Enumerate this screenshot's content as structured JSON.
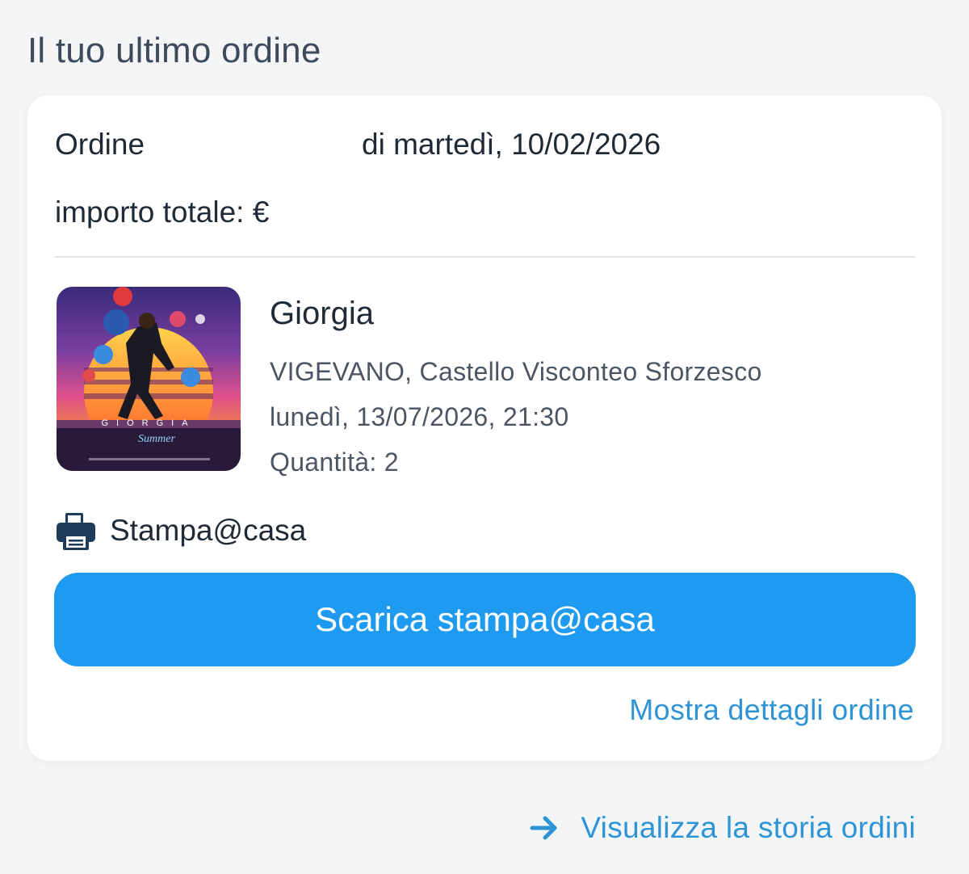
{
  "section": {
    "title": "Il tuo ultimo ordine"
  },
  "order": {
    "label": "Ordine",
    "date": "di martedì, 10/02/2026",
    "total": "importo totale: €"
  },
  "event": {
    "image_icon": "event-poster-image",
    "image_text": "GIORGIA Summer",
    "title": "Giorgia",
    "venue": "VIGEVANO, Castello Visconteo Sforzesco",
    "datetime": "lunedì, 13/07/2026, 21:30",
    "quantity": "Quantità: 2"
  },
  "delivery": {
    "icon": "printer-icon",
    "label": "Stampa@casa"
  },
  "actions": {
    "download_label": "Scarica stampa@casa",
    "details_label": "Mostra dettagli ordine",
    "history_icon": "arrow-right-icon",
    "history_label": "Visualizza la storia ordini"
  },
  "colors": {
    "accent": "#1e9bf0",
    "link": "#2e94d6",
    "background": "#f4f5f7",
    "card": "#ffffff"
  }
}
